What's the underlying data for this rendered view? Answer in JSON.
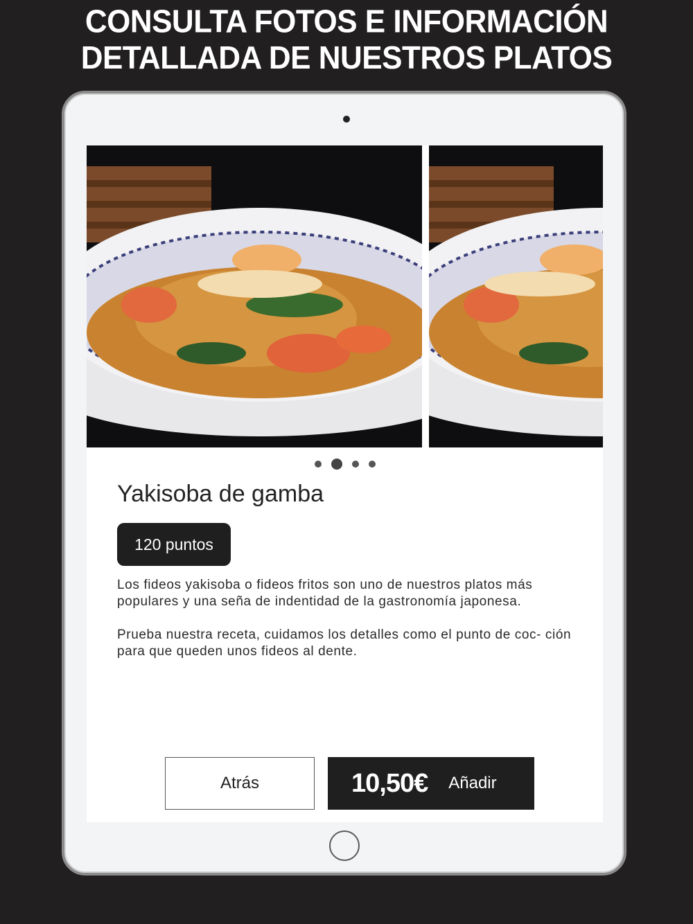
{
  "headline": {
    "line1": "CONSULTA FOTOS E INFORMACIÓN",
    "line2": "DETALLADA DE NUESTROS PLATOS"
  },
  "gallery": {
    "photo_count": 4,
    "active_index": 1
  },
  "dish": {
    "name": "Yakisoba de gamba",
    "points": "120 puntos",
    "description_1": "Los fideos yakisoba o fideos fritos son uno de nuestros platos más populares y una seña de indentidad de la gastronomía japonesa.",
    "description_2": "Prueba nuestra receta, cuidamos los detalles como el punto de coc- ción para que queden unos fideos al dente."
  },
  "actions": {
    "back_label": "Atrás",
    "price": "10,50€",
    "add_label": "Añadir"
  }
}
